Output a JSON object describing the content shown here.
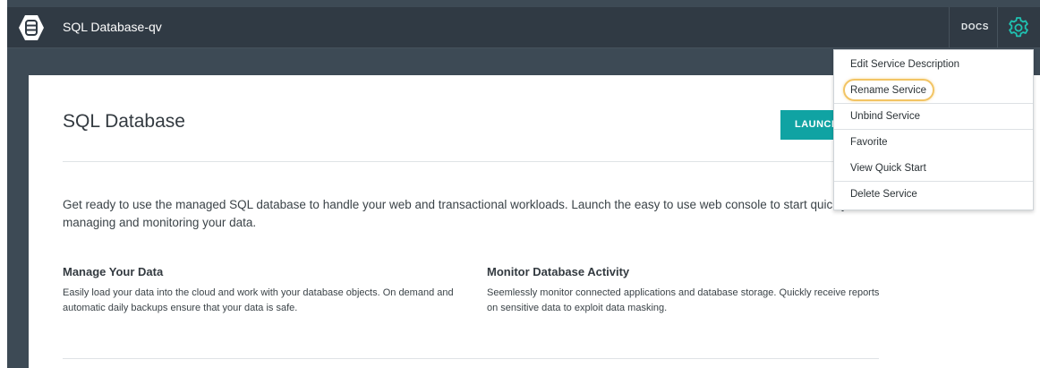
{
  "header": {
    "service_title": "SQL Database-qv",
    "docs_label": "DOCS",
    "logo_icon": "database-icon",
    "settings_icon": "gear-icon"
  },
  "colors": {
    "topbar": "#303a44",
    "backdrop": "#3d4a55",
    "accent": "#10a3a3",
    "highlight": "#f2c464"
  },
  "main": {
    "title": "SQL Database",
    "launch_label": "LAUNCH",
    "intro": "Get ready to use the managed SQL database to handle your web and transactional workloads. Launch the easy to use web console to start quickly managing and monitoring your data.",
    "features": [
      {
        "heading": "Manage Your Data",
        "body": "Easily load your data into the cloud and work with your database objects. On demand and automatic daily backups ensure that your data is safe."
      },
      {
        "heading": "Monitor Database Activity",
        "body": "Seemlessly monitor connected applications and database storage. Quickly receive reports on sensitive data to exploit data masking."
      }
    ]
  },
  "menu": {
    "items": [
      {
        "label": "Edit Service Description"
      },
      {
        "label": "Rename Service"
      },
      {
        "label": "Unbind Service"
      },
      {
        "label": "Favorite"
      },
      {
        "label": "View Quick Start"
      },
      {
        "label": "Delete Service"
      }
    ]
  }
}
